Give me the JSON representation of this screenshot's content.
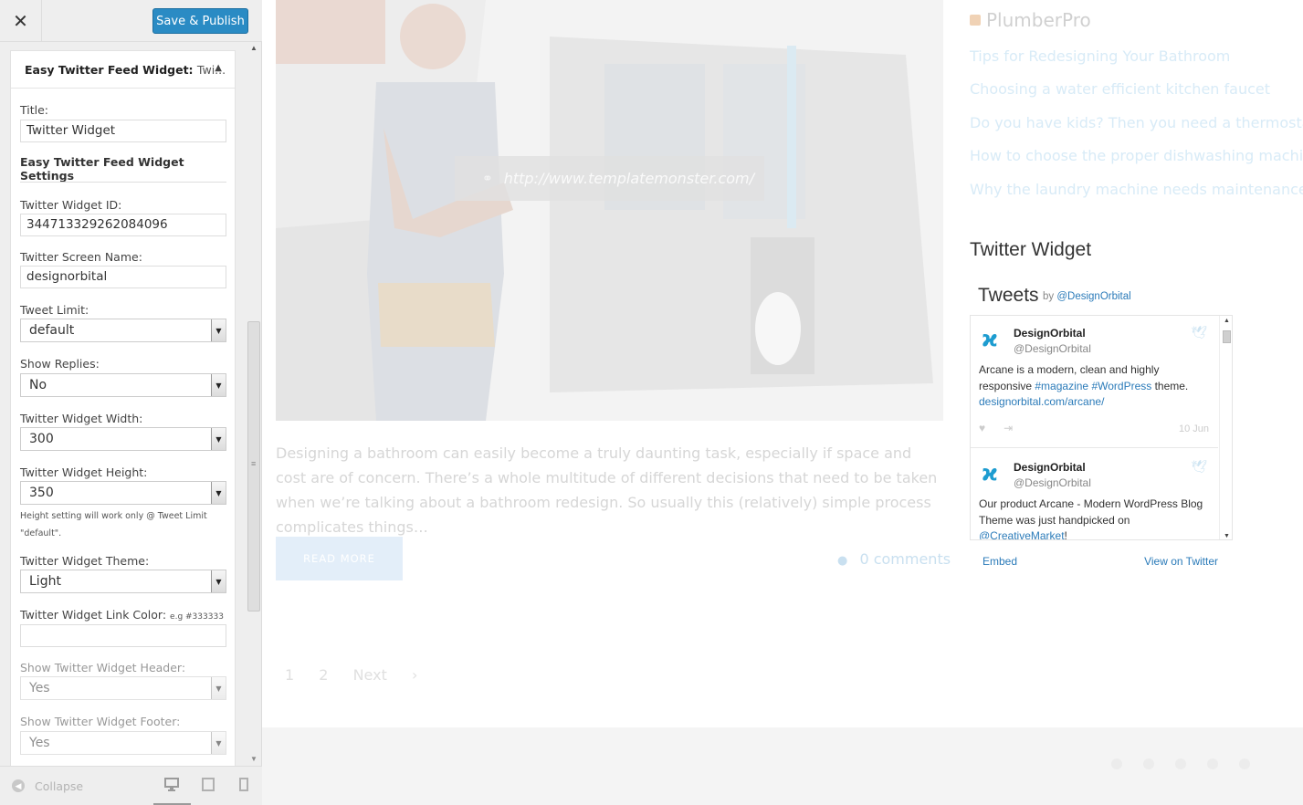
{
  "toolbar": {
    "close_glyph": "✕",
    "publish_label": "Save & Publish"
  },
  "widget": {
    "header_title": "Easy Twitter Feed Widget:",
    "header_sub": "Twi...",
    "title_label": "Title:",
    "title_value": "Twitter Widget",
    "settings_heading": "Easy Twitter Feed Widget Settings",
    "fields": {
      "widget_id": {
        "label": "Twitter Widget ID:",
        "value": "344713329262084096"
      },
      "screen_name": {
        "label": "Twitter Screen Name:",
        "value": "designorbital"
      },
      "tweet_limit": {
        "label": "Tweet Limit:",
        "value": "default"
      },
      "show_replies": {
        "label": "Show Replies:",
        "value": "No"
      },
      "width": {
        "label": "Twitter Widget Width:",
        "value": "300"
      },
      "height": {
        "label": "Twitter Widget Height:",
        "value": "350"
      },
      "height_note": "Height setting will work only @ Tweet Limit \"default\".",
      "theme": {
        "label": "Twitter Widget Theme:",
        "value": "Light"
      },
      "link_color": {
        "label": "Twitter Widget Link Color:",
        "hint": "e.g #333333",
        "value": ""
      },
      "show_header": {
        "label": "Show Twitter Widget Header:",
        "value": "Yes"
      },
      "show_footer": {
        "label": "Show Twitter Widget Footer:",
        "value": "Yes"
      }
    }
  },
  "footer": {
    "collapse_label": "Collapse",
    "devices": [
      "desktop-icon",
      "tablet-icon",
      "mobile-icon"
    ]
  },
  "preview": {
    "url_text": "http://www.templatemonster.com/",
    "excerpt": "Designing a bathroom can easily become a truly daunting task, especially if space and cost are of concern. There’s a whole multitude of different decisions that need to be taken when we’re talking about a bathroom redesign. So usually this (relatively) simple process complicates things…",
    "read_more": "READ MORE",
    "comments": "0 comments",
    "pager": [
      "1",
      "2",
      "Next"
    ],
    "sidebar": {
      "rss_title": "PlumberPro",
      "posts": [
        "Tips for Redesigning Your Bathroom",
        "Choosing a water efficient kitchen faucet",
        "Do you have kids? Then you need a thermostat!",
        "How to choose the proper dishwashing machine",
        "Why the laundry machine needs maintenance"
      ],
      "twitter_widget_title": "Twitter Widget",
      "timeline": {
        "tweets_label": "Tweets",
        "by_label": "by",
        "by_handle": "@DesignOrbital",
        "embed": "Embed",
        "view_on_twitter": "View on Twitter",
        "tweets": [
          {
            "name": "DesignOrbital",
            "handle": "@DesignOrbital",
            "text_parts": [
              "Arcane is a modern, clean and highly responsive ",
              "#magazine",
              " ",
              "#WordPress",
              " theme. ",
              "designorbital.com/arcane/"
            ],
            "date": "10 Jun"
          },
          {
            "name": "DesignOrbital",
            "handle": "@DesignOrbital",
            "text_parts": [
              "Our product Arcane - Modern WordPress Blog Theme was just handpicked on ",
              "@CreativeMarket",
              "!"
            ],
            "date": ""
          }
        ]
      }
    }
  },
  "colors": {
    "publish_bg": "#2a8bc4",
    "link_blue": "#2b7bb9",
    "twitter_logo": "#1d9cd0"
  }
}
